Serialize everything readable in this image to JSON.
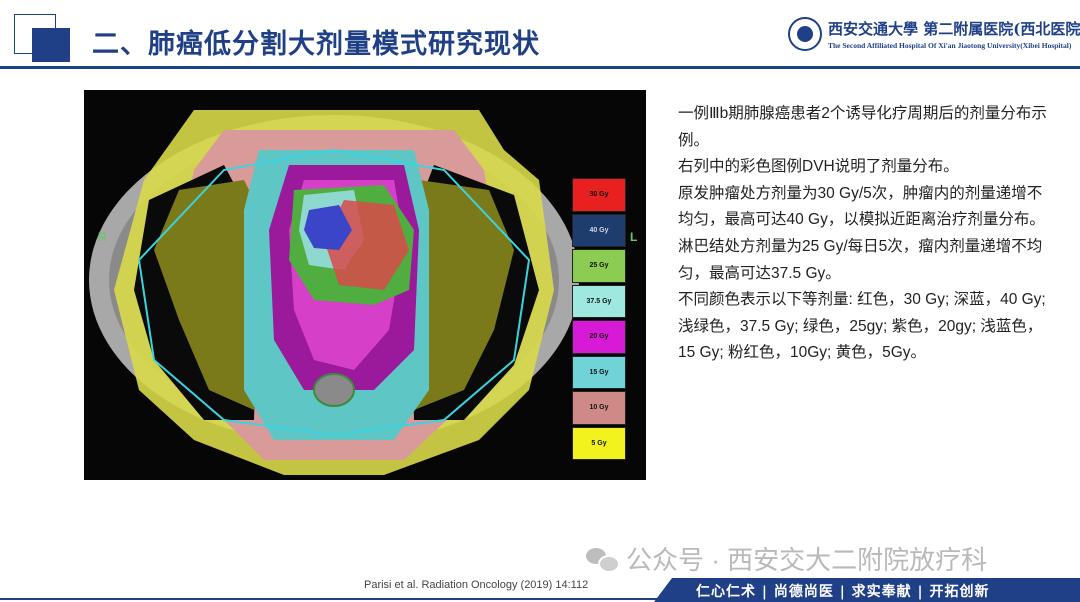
{
  "header": {
    "title": "二、肺癌低分割大剂量模式研究现状",
    "logo_cn": "西安交通大學 第二附属医院(西北医院)",
    "logo_en": "The Second Affiliated Hospital Of Xi'an Jiaotong University(Xibei Hospital)"
  },
  "figure": {
    "orientation_left": "R",
    "orientation_right": "L",
    "legend": [
      {
        "label": "30 Gy",
        "color": "#e8201f"
      },
      {
        "label": "40 Gy",
        "color": "#1e3c6e"
      },
      {
        "label": "25 Gy",
        "color": "#8dcc52"
      },
      {
        "label": "37.5 Gy",
        "color": "#9fe8e0"
      },
      {
        "label": "20 Gy",
        "color": "#d61ad6"
      },
      {
        "label": "15 Gy",
        "color": "#6fd3d8"
      },
      {
        "label": "10 Gy",
        "color": "#cf8a88"
      },
      {
        "label": "5 Gy",
        "color": "#f2f21e"
      }
    ]
  },
  "description": {
    "paragraphs": [
      "一例Ⅲb期肺腺癌患者2个诱导化疗周期后的剂量分布示例。",
      "右列中的彩色图例DVH说明了剂量分布。",
      "原发肿瘤处方剂量为30 Gy/5次，肿瘤内的剂量递增不均匀，最高可达40 Gy，以模拟近距离治疗剂量分布。",
      "淋巴结处方剂量为25 Gy/每日5次，瘤内剂量递增不均匀，最高可达37.5 Gy。",
      "不同颜色表示以下等剂量: 红色，30 Gy; 深蓝，40 Gy; 浅绿色，37.5 Gy; 绿色，25gy; 紫色，20gy; 浅蓝色，15 Gy; 粉红色，10Gy; 黄色，5Gy。"
    ]
  },
  "footer": {
    "citation": "Parisi et al. Radiation Oncology (2019) 14:112",
    "watermark": "公众号 · 西安交大二附院放疗科",
    "motto": "仁心仁术 | 尚德尚医 | 求实奉献 | 开拓创新"
  }
}
